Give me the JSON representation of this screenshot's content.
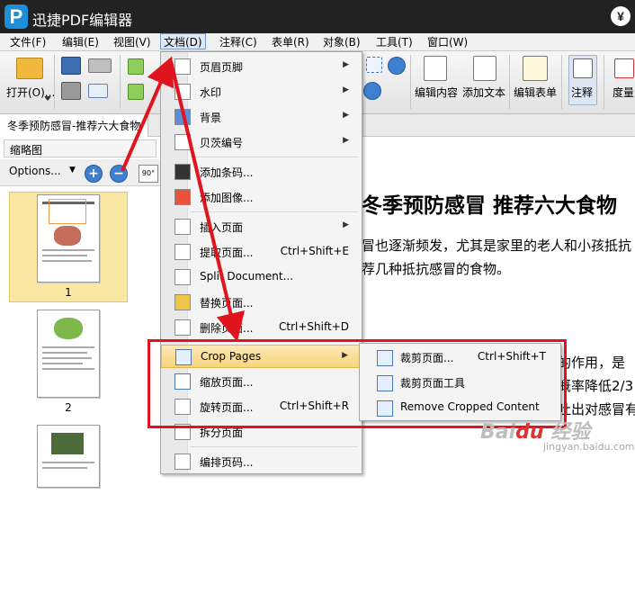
{
  "app": {
    "title": "迅捷PDF编辑器",
    "logo": "P",
    "account_glyph": "¥"
  },
  "menubar": [
    {
      "label": "文件(F)"
    },
    {
      "label": "编辑(E)"
    },
    {
      "label": "视图(V)"
    },
    {
      "label": "文档(D)"
    },
    {
      "label": "注释(C)"
    },
    {
      "label": "表单(R)"
    },
    {
      "label": "对象(B)"
    },
    {
      "label": "工具(T)"
    },
    {
      "label": "窗口(W)"
    }
  ],
  "toolbar": {
    "open_label": "打开(O)...",
    "edit_content": "编辑内容",
    "add_text": "添加文本",
    "edit_form": "编辑表单",
    "annotate": "注释",
    "measure": "度量"
  },
  "tab": {
    "label": "冬季预防感冒-推荐六大食物"
  },
  "left_panel": {
    "header": "缩略图",
    "options_label": "Options...",
    "rotate_label": "90°",
    "page_numbers": [
      "1",
      "2"
    ]
  },
  "document": {
    "title": "冬季预防感冒 推荐六大食物",
    "line1": "冒也逐渐频发，尤其是家里的老人和小孩抵抗",
    "line2": "荐几种抵抗感冒的食物。",
    "line3": "的作用，是",
    "line4": "概率降低2/3",
    "line5": "吐出对感冒有"
  },
  "doc_menu": {
    "items": [
      {
        "label": "页眉页脚",
        "shortcut": "",
        "submenu": true,
        "icon": "header-footer-icon"
      },
      {
        "label": "水印",
        "shortcut": "",
        "submenu": true,
        "icon": "watermark-icon"
      },
      {
        "label": "背景",
        "shortcut": "",
        "submenu": true,
        "icon": "background-icon"
      },
      {
        "label": "贝茨编号",
        "shortcut": "",
        "submenu": true,
        "icon": "bates-number-icon"
      },
      {
        "label": "添加条码...",
        "shortcut": "",
        "submenu": false,
        "icon": "barcode-icon"
      },
      {
        "label": "添加图像...",
        "shortcut": "",
        "submenu": false,
        "icon": "add-image-icon"
      },
      {
        "label": "插入页面",
        "shortcut": "",
        "submenu": true,
        "icon": "insert-page-icon"
      },
      {
        "label": "提取页面...",
        "shortcut": "Ctrl+Shift+E",
        "submenu": false,
        "icon": "extract-page-icon"
      },
      {
        "label": "Split Document...",
        "shortcut": "",
        "submenu": false,
        "icon": "split-document-icon"
      },
      {
        "label": "替换页面...",
        "shortcut": "",
        "submenu": false,
        "icon": "replace-page-icon"
      },
      {
        "label": "删除页面...",
        "shortcut": "Ctrl+Shift+D",
        "submenu": false,
        "icon": "delete-page-icon"
      },
      {
        "label": "Crop Pages",
        "shortcut": "",
        "submenu": true,
        "icon": "crop-pages-icon"
      },
      {
        "label": "缩放页面...",
        "shortcut": "",
        "submenu": false,
        "icon": "resize-page-icon"
      },
      {
        "label": "旋转页面...",
        "shortcut": "Ctrl+Shift+R",
        "submenu": false,
        "icon": "rotate-page-icon"
      },
      {
        "label": "拆分页面",
        "shortcut": "",
        "submenu": false,
        "icon": "split-page-icon"
      },
      {
        "label": "编排页码...",
        "shortcut": "",
        "submenu": false,
        "icon": "page-numbering-icon"
      }
    ]
  },
  "crop_submenu": {
    "items": [
      {
        "label": "裁剪页面...",
        "shortcut": "Ctrl+Shift+T",
        "icon": "crop-page-icon"
      },
      {
        "label": "裁剪页面工具",
        "shortcut": "",
        "icon": "crop-tool-icon"
      },
      {
        "label": "Remove Cropped Content",
        "shortcut": "",
        "icon": "remove-cropped-icon"
      }
    ]
  },
  "colors": {
    "highlight": "#f8d57d",
    "annotation_red": "#e0141f",
    "titlebar": "#222222"
  }
}
